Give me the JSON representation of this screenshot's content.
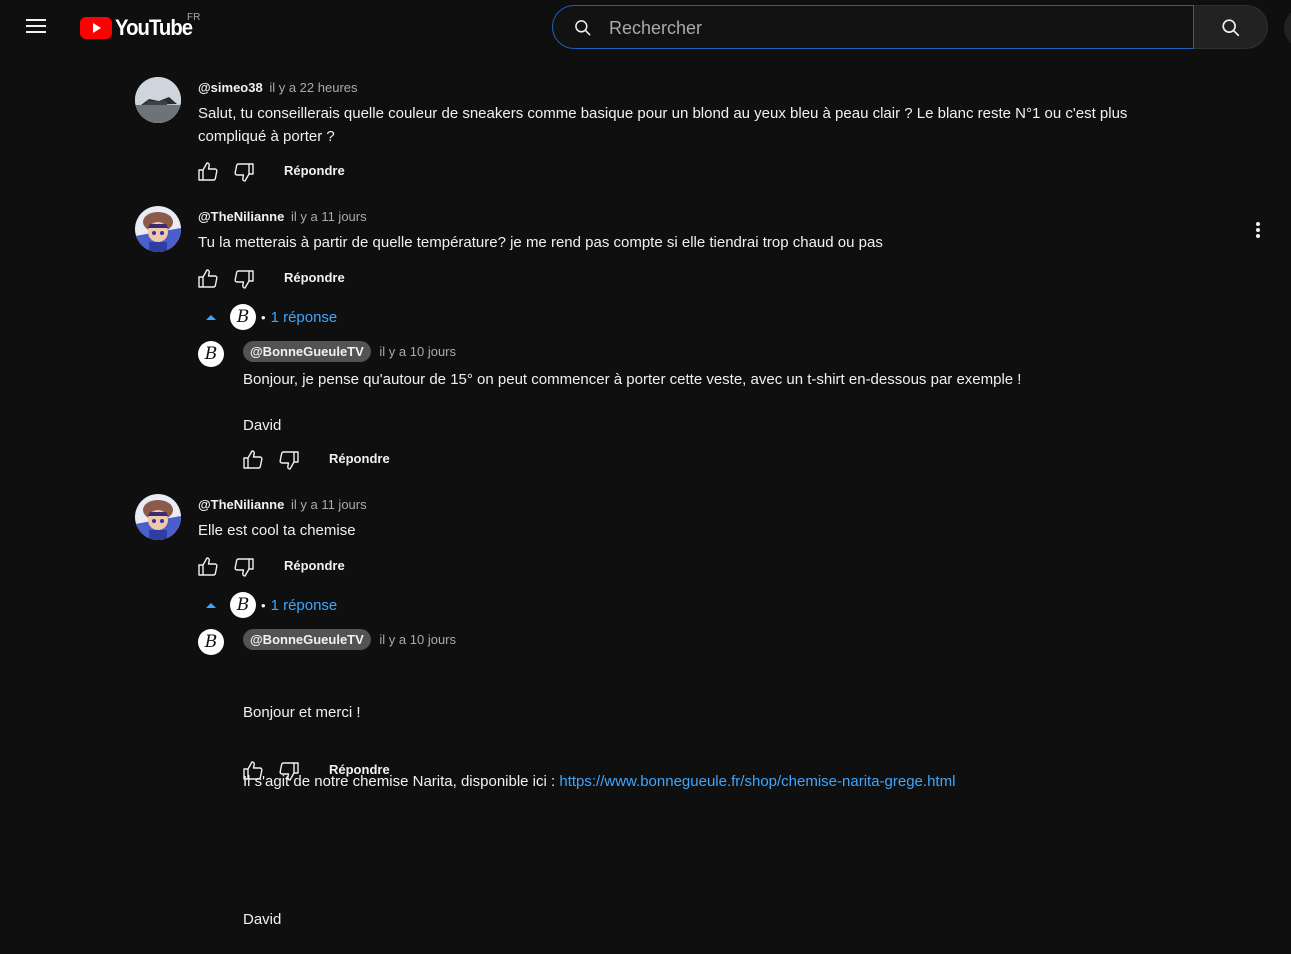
{
  "header": {
    "logo_text": "YouTube",
    "country_code": "FR",
    "search_placeholder": "Rechercher"
  },
  "colors": {
    "background": "#0f0f0f",
    "link": "#3ea6ff",
    "youtube_red": "#ff0000"
  },
  "comments": [
    {
      "author": "@simeo38",
      "time": "il y a 22 heures",
      "text": "Salut, tu conseillerais quelle couleur de sneakers comme basique pour un blond au yeux bleu à peau clair ? Le blanc reste N°1 ou c'est plus\ncompliqué à porter ?",
      "reply_label": "Répondre"
    },
    {
      "author": "@TheNilianne",
      "time": "il y a 11 jours",
      "text": "Tu la metterais à partir de quelle température? je me rend pas compte si elle tiendrai trop chaud ou pas",
      "reply_label": "Répondre",
      "replies_count": "1 réponse",
      "reply": {
        "author": "@BonneGueuleTV",
        "time": "il y a 10 jours",
        "text": "Bonjour, je pense qu'autour de 15° on peut commencer à porter cette veste, avec un t-shirt en-dessous par exemple !\n\nDavid",
        "reply_label": "Répondre"
      }
    },
    {
      "author": "@TheNilianne",
      "time": "il y a 11 jours",
      "text": "Elle est cool ta chemise",
      "reply_label": "Répondre",
      "replies_count": "1 réponse",
      "reply": {
        "author": "@BonneGueuleTV",
        "time": "il y a 10 jours",
        "text_line1": "Bonjour et merci !",
        "text_line2_prefix": "Il s'agit de notre chemise Narita, disponible ici : ",
        "link": "https://www.bonnegueule.fr/shop/chemise-narita-grege.html",
        "signature": "David",
        "reply_label": "Répondre"
      }
    }
  ],
  "avatar_letter": "B"
}
